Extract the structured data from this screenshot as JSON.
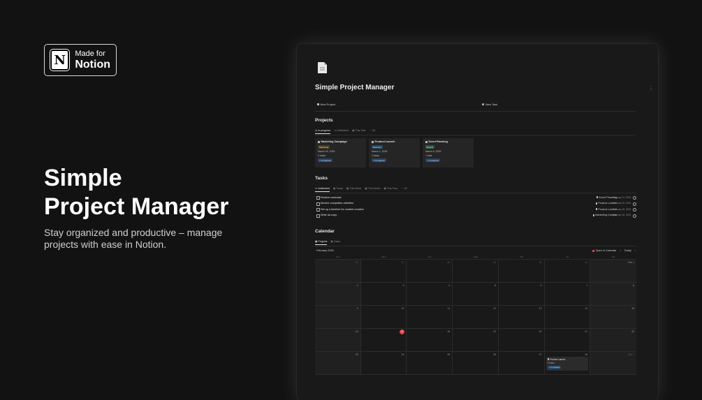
{
  "badge": {
    "line1": "Made for",
    "line2": "Notion",
    "logo_letter": "N"
  },
  "hero": {
    "title_line1": "Simple",
    "title_line2": "Project Manager",
    "subtitle": "Stay organized and productive – manage projects with ease in Notion."
  },
  "notion": {
    "page_title": "Simple Project Manager",
    "new_project": "New Project",
    "new_task": "New Task",
    "projects": {
      "heading": "Projects",
      "tabs": [
        "In progress",
        "Unfinished",
        "This Year",
        "All"
      ],
      "cards": [
        {
          "name": "Marketing Campaign",
          "tag": "Marketing",
          "tag_color": "#4a3a24",
          "date": "March 29, 2025",
          "count": "2 tasks",
          "status": "In progress"
        },
        {
          "name": "Product Launch",
          "tag": "Business",
          "tag_color": "#244a6b",
          "date": "March 1, 2025",
          "count": "2 tasks",
          "status": "In progress"
        },
        {
          "name": "Event Planning",
          "tag": "Events",
          "tag_color": "#2e5a3e",
          "date": "March 8, 2025",
          "count": "1 task",
          "status": "In progress"
        }
      ]
    },
    "tasks": {
      "heading": "Tasks",
      "tabs": [
        "Unfinished",
        "Today",
        "This Week",
        "This Month",
        "This Year",
        "All"
      ],
      "rows": [
        {
          "name": "Finalize contracts",
          "project": "Event Planning",
          "date": "February 21, 2025"
        },
        {
          "name": "Monitor competitor activities",
          "project": "Product Launch",
          "date": "February 22, 2025"
        },
        {
          "name": "Set up a timeline for content creation",
          "project": "Product Launch",
          "date": "February 18, 2025"
        },
        {
          "name": "Write ad copy",
          "project": "Marketing Campai",
          "date": "February 18, 2025"
        }
      ]
    },
    "calendar": {
      "heading": "Calendar",
      "tabs": [
        "Projects",
        "Tasks"
      ],
      "month": "February 2025",
      "open_in_calendar": "Open in Calendar",
      "today": "Today",
      "days_of_week": [
        "Sun",
        "Mon",
        "Tue",
        "Wed",
        "Thu",
        "Fri",
        "Sat"
      ],
      "days": [
        "26",
        "27",
        "28",
        "29",
        "30",
        "31",
        "Feb 1",
        "2",
        "3",
        "4",
        "5",
        "6",
        "7",
        "8",
        "9",
        "10",
        "11",
        "12",
        "13",
        "14",
        "15",
        "16",
        "17",
        "18",
        "19",
        "20",
        "21",
        "22",
        "23",
        "24",
        "25",
        "26",
        "27",
        "28",
        "Mar 1"
      ],
      "today_day": "17",
      "event": {
        "name": "Product Launch",
        "count": "2 tasks",
        "status": "In progress"
      }
    }
  }
}
